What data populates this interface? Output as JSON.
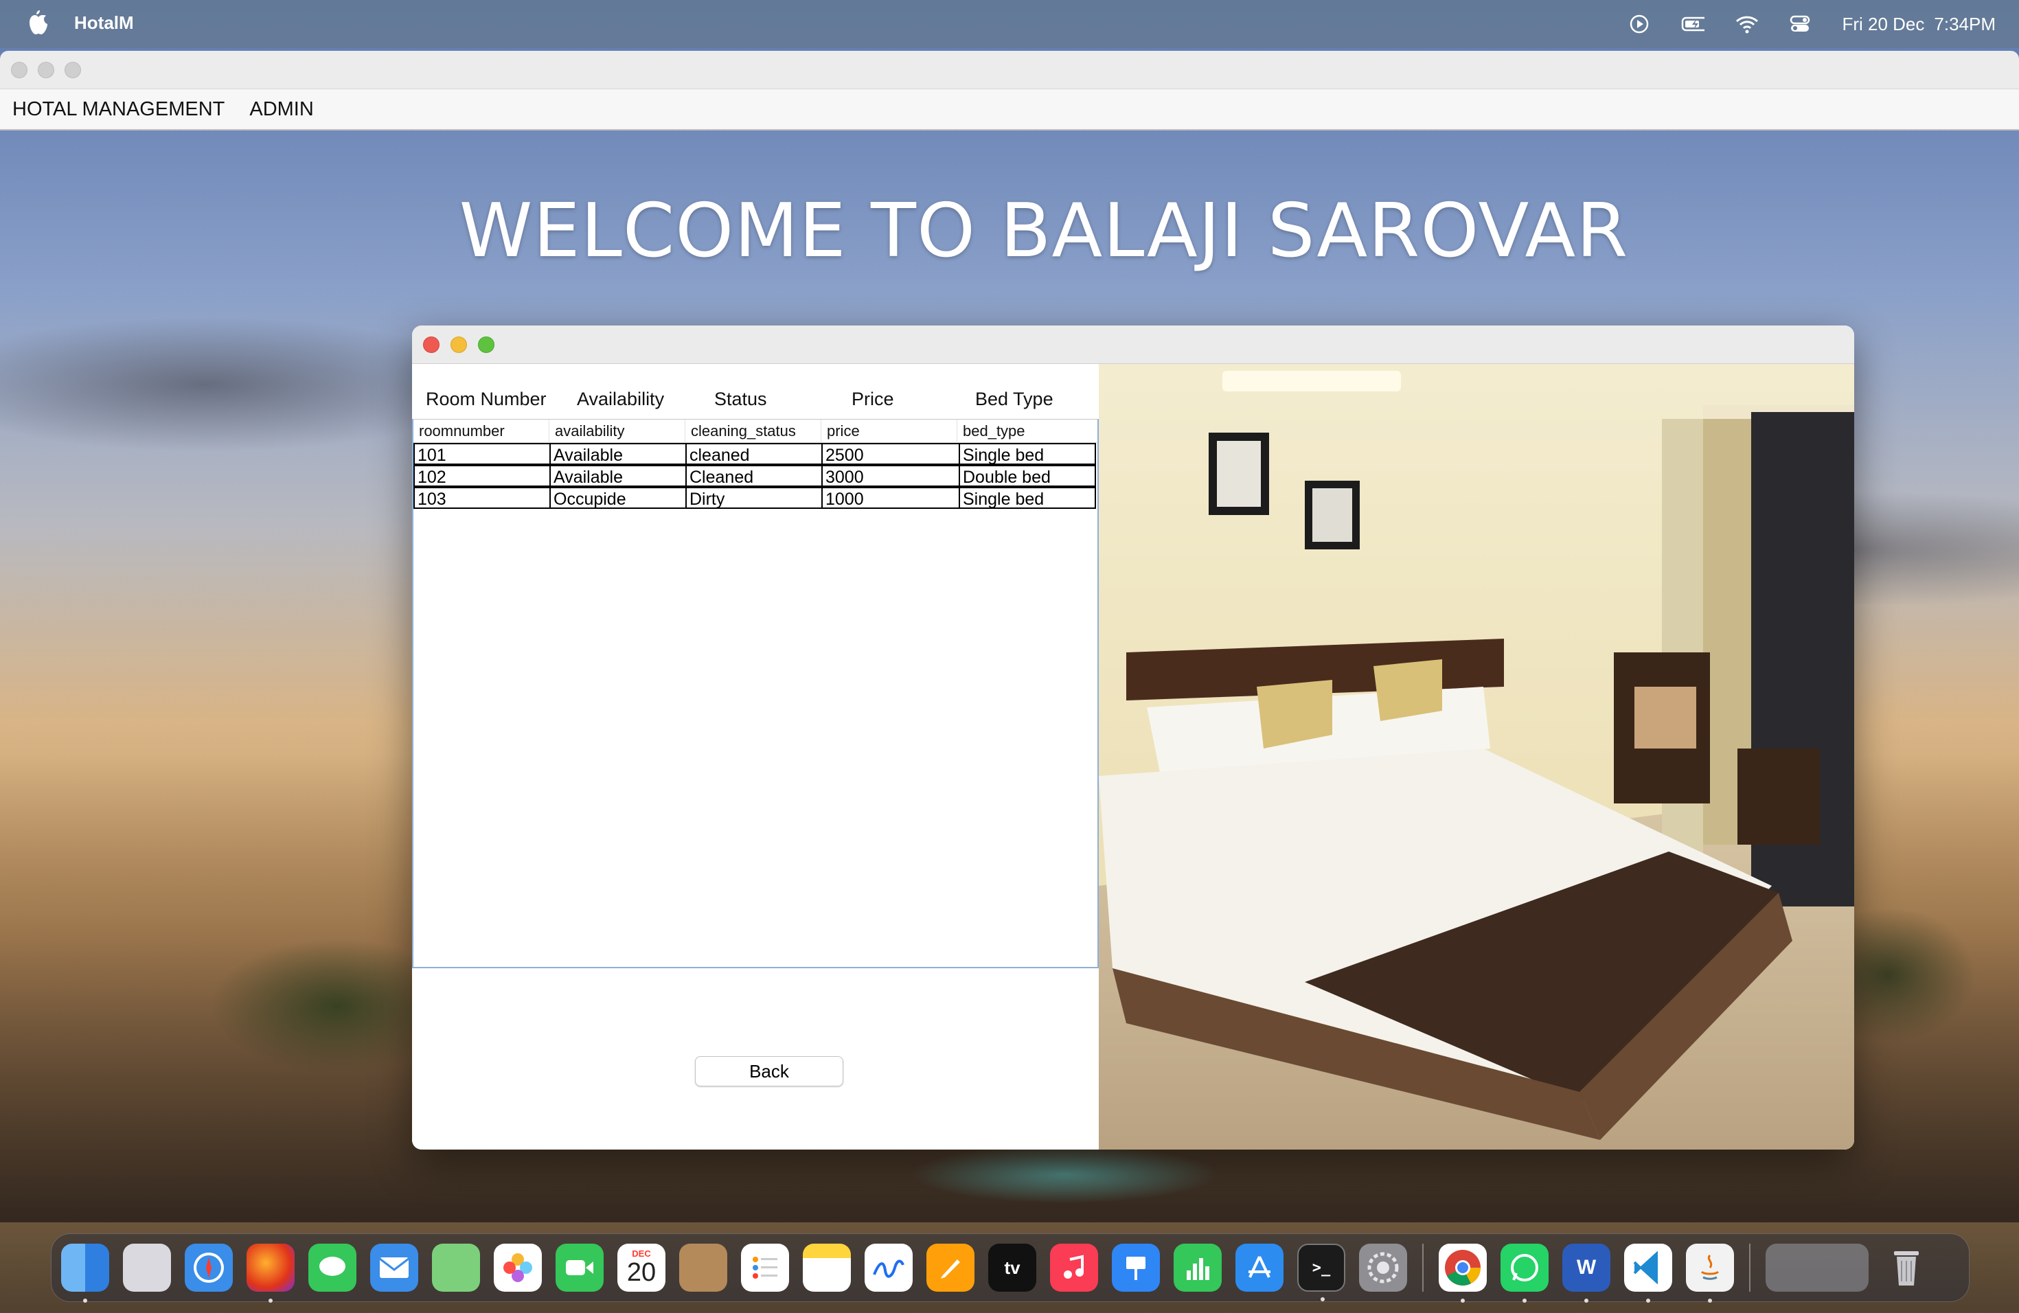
{
  "menubar": {
    "app_name": "HotalM",
    "date": "Fri 20 Dec",
    "time": "7:34PM",
    "icons": [
      "apple-icon",
      "play-circle-icon",
      "battery-icon",
      "wifi-icon",
      "control-center-icon"
    ]
  },
  "app": {
    "menu": [
      "HOTAL MANAGEMENT",
      "ADMIN"
    ],
    "welcome": "WELCOME TO BALAJI SAROVAR"
  },
  "dialog": {
    "headings": [
      "Room Number",
      "Availability",
      "Status",
      "Price",
      "Bed Type"
    ],
    "table": {
      "columns": [
        "roomnumber",
        "availability",
        "cleaning_status",
        "price",
        "bed_type"
      ],
      "rows": [
        [
          "101",
          "Available",
          "cleaned",
          "2500",
          "Single bed"
        ],
        [
          "102",
          "Available",
          "Cleaned",
          "3000",
          "Double bed"
        ],
        [
          "103",
          "Occupide",
          "Dirty",
          "1000",
          "Single bed"
        ]
      ]
    },
    "back_label": "Back"
  },
  "dock": {
    "apps": [
      "Finder",
      "Launchpad",
      "Safari",
      "Firefox",
      "Messages",
      "Mail",
      "Maps",
      "Photos",
      "FaceTime",
      "Calendar",
      "Contacts",
      "Reminders",
      "Notes",
      "Freeform",
      "Pages",
      "TV",
      "Music",
      "Keynote",
      "Numbers",
      "App Store",
      "Terminal",
      "System Settings",
      "Chrome",
      "WhatsApp",
      "Word",
      "VS Code",
      "Java"
    ],
    "calendar_month": "DEC",
    "calendar_day": "20",
    "tv_label": "tv"
  },
  "colors": {
    "menubar": "#647a96",
    "close": "#ee5a52",
    "minimize": "#f4bd3a",
    "zoom": "#5fc23e"
  }
}
